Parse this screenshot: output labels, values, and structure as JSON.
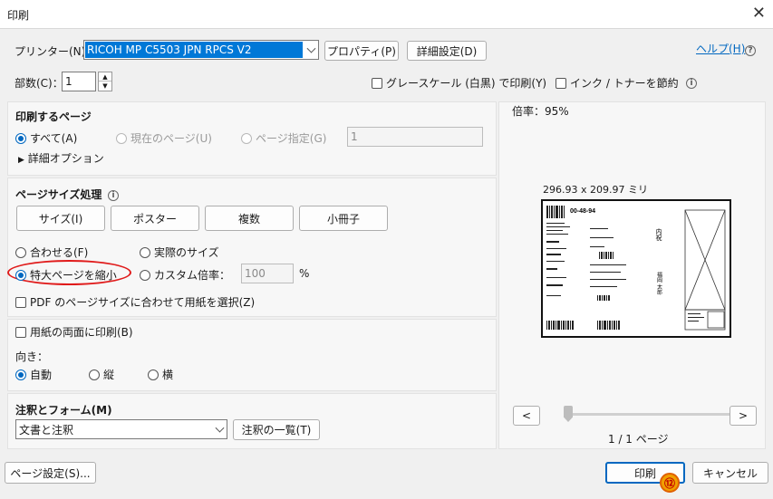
{
  "window": {
    "title": "印刷",
    "close_glyph": "✕"
  },
  "printer": {
    "label": "プリンター(N)：",
    "selected": "RICOH MP C5503 JPN RPCS V2",
    "properties_button": "プロパティ(P)",
    "advanced_button": "詳細設定(D)",
    "help_link": "ヘルプ(H)",
    "copies_label": "部数(C)：",
    "copies_value": "1",
    "grayscale_label": "グレースケール (白黒) で印刷(Y)",
    "save_ink_label": "インク / トナーを節約"
  },
  "pages": {
    "title": "印刷するページ",
    "all": "すべて(A)",
    "current": "現在のページ(U)",
    "range": "ページ指定(G)",
    "range_value": "1",
    "more_options": "詳細オプション"
  },
  "sizing": {
    "title": "ページサイズ処理",
    "tabs": [
      "サイズ(I)",
      "ポスター",
      "複数",
      "小冊子"
    ],
    "fit": "合わせる(F)",
    "actual": "実際のサイズ",
    "shrink": "特大ページを縮小",
    "custom": "カスタム倍率：",
    "custom_value": "100",
    "percent": "%",
    "choose_paper": "PDF のページサイズに合わせて用紙を選択(Z)"
  },
  "duplex": {
    "label": "用紙の両面に印刷(B)",
    "orientation_label": "向き：",
    "auto": "自動",
    "portrait": "縦",
    "landscape": "横"
  },
  "annotations": {
    "title": "注釈とフォーム(M)",
    "selected": "文書と注釈",
    "summary_button": "注釈の一覧(T)"
  },
  "preview": {
    "scale": "倍率：95%",
    "dimensions": "296.93 x 209.97 ミリ",
    "page_counter": "1 / 1 ページ",
    "prev": "<",
    "next": ">",
    "doc_date": "00-48-94",
    "doc_text_1": "内祝",
    "doc_text_2": "福岡 太郎"
  },
  "footer": {
    "page_setup": "ページ設定(S)...",
    "print": "印刷",
    "cancel": "キャンセル",
    "step_badge": "⑫"
  },
  "colors": {
    "accent": "#0067c0",
    "highlight": "#0078d7",
    "annotation_red": "#e01b1b",
    "badge_orange": "#f0a000"
  }
}
